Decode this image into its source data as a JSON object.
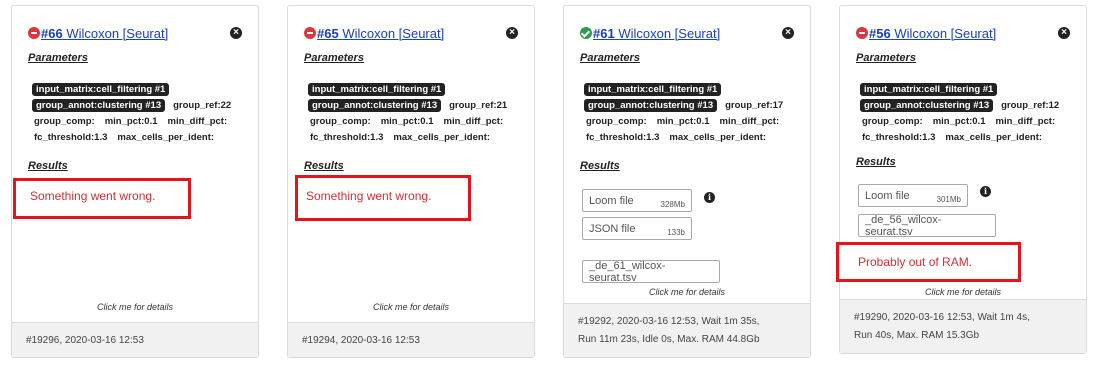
{
  "cards": [
    {
      "status": "error",
      "number": "#66",
      "title": "Wilcoxon [Seurat]",
      "parameters_label": "Parameters",
      "params": {
        "line1": [
          "input_matrix:cell_filtering #1"
        ],
        "line2_pill": "group_annot:clustering #13",
        "line2_plain": "group_ref:22",
        "line3": [
          "group_comp:",
          "min_pct:0.1",
          "min_diff_pct:"
        ],
        "line4": [
          "fc_threshold:1.3",
          "max_cells_per_ident:"
        ]
      },
      "results_label": "Results",
      "error_text": "Something went wrong.",
      "click_note": "Click me for details",
      "footer": [
        "#19296, 2020-03-16 12:53"
      ]
    },
    {
      "status": "error",
      "number": "#65",
      "title": "Wilcoxon [Seurat]",
      "parameters_label": "Parameters",
      "params": {
        "line1": [
          "input_matrix:cell_filtering #1"
        ],
        "line2_pill": "group_annot:clustering #13",
        "line2_plain": "group_ref:21",
        "line3": [
          "group_comp:",
          "min_pct:0.1",
          "min_diff_pct:"
        ],
        "line4": [
          "fc_threshold:1.3",
          "max_cells_per_ident:"
        ]
      },
      "results_label": "Results",
      "error_text": "Something went wrong.",
      "click_note": "Click me for details",
      "footer": [
        "#19294, 2020-03-16 12:53"
      ]
    },
    {
      "status": "success",
      "number": "#61",
      "title": "Wilcoxon [Seurat]",
      "parameters_label": "Parameters",
      "params": {
        "line1": [
          "input_matrix:cell_filtering #1"
        ],
        "line2_pill": "group_annot:clustering #13",
        "line2_plain": "group_ref:17",
        "line3": [
          "group_comp:",
          "min_pct:0.1",
          "min_diff_pct:"
        ],
        "line4": [
          "fc_threshold:1.3",
          "max_cells_per_ident:"
        ]
      },
      "results_label": "Results",
      "files": [
        {
          "name": "Loom file",
          "size": "328Mb"
        },
        {
          "name": "JSON file",
          "size": "133b"
        },
        {
          "name": "_de_61_wilcox-seurat.tsv",
          "size": ""
        }
      ],
      "click_note": "Click me for details",
      "footer": [
        "#19292, 2020-03-16 12:53, Wait 1m 35s,",
        "Run 11m 23s, Idle 0s, Max. RAM 44.8Gb"
      ]
    },
    {
      "status": "error",
      "number": "#56",
      "title": "Wilcoxon [Seurat]",
      "parameters_label": "Parameters",
      "params": {
        "line1": [
          "input_matrix:cell_filtering #1"
        ],
        "line2_pill": "group_annot:clustering #13",
        "line2_plain": "group_ref:12",
        "line3": [
          "group_comp:",
          "min_pct:0.1",
          "min_diff_pct:"
        ],
        "line4": [
          "fc_threshold:1.3",
          "max_cells_per_ident:"
        ]
      },
      "results_label": "Results",
      "files": [
        {
          "name": "Loom file",
          "size": "301Mb"
        },
        {
          "name": "_de_56_wilcox-seurat.tsv",
          "size": ""
        }
      ],
      "error_text": "Probably out of RAM.",
      "click_note": "Click me for details",
      "footer": [
        "#19290, 2020-03-16 12:53, Wait 1m 4s,",
        "Run 40s, Max. RAM 15.3Gb"
      ]
    }
  ],
  "colors": {
    "error_red": "#d62e36",
    "highlight_red": "#e3141b",
    "link_blue": "#1a3fbf",
    "success_green": "#2e9b4d"
  },
  "icons": {
    "close": "close-icon",
    "info": "info-icon",
    "error": "error-status-icon",
    "success": "success-status-icon"
  }
}
